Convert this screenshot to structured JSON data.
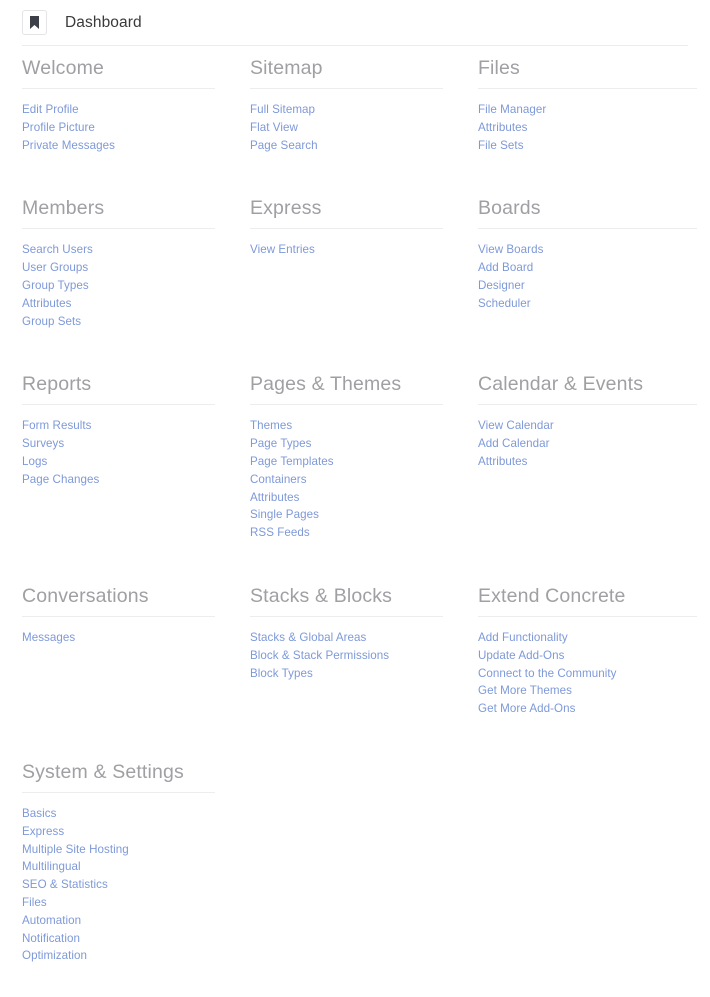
{
  "header": {
    "icon": "bookmark-icon",
    "title": "Dashboard"
  },
  "colors": {
    "link": "#7e99d8",
    "heading": "#a0a0a4",
    "title": "#3a3a3c",
    "divider": "#ededef",
    "background": "#ffffff"
  },
  "groups": [
    {
      "id": "welcome",
      "title": "Welcome",
      "links": [
        "Edit Profile",
        "Profile Picture",
        "Private Messages"
      ]
    },
    {
      "id": "sitemap",
      "title": "Sitemap",
      "links": [
        "Full Sitemap",
        "Flat View",
        "Page Search"
      ]
    },
    {
      "id": "files",
      "title": "Files",
      "links": [
        "File Manager",
        "Attributes",
        "File Sets"
      ]
    },
    {
      "id": "members",
      "title": "Members",
      "links": [
        "Search Users",
        "User Groups",
        "Group Types",
        "Attributes",
        "Group Sets"
      ]
    },
    {
      "id": "express",
      "title": "Express",
      "links": [
        "View Entries"
      ]
    },
    {
      "id": "boards",
      "title": "Boards",
      "links": [
        "View Boards",
        "Add Board",
        "Designer",
        "Scheduler"
      ]
    },
    {
      "id": "reports",
      "title": "Reports",
      "links": [
        "Form Results",
        "Surveys",
        "Logs",
        "Page Changes"
      ]
    },
    {
      "id": "pages-themes",
      "title": "Pages & Themes",
      "links": [
        "Themes",
        "Page Types",
        "Page Templates",
        "Containers",
        "Attributes",
        "Single Pages",
        "RSS Feeds"
      ]
    },
    {
      "id": "calendar-events",
      "title": "Calendar & Events",
      "links": [
        "View Calendar",
        "Add Calendar",
        "Attributes"
      ]
    },
    {
      "id": "conversations",
      "title": "Conversations",
      "links": [
        "Messages"
      ]
    },
    {
      "id": "stacks-blocks",
      "title": "Stacks & Blocks",
      "links": [
        "Stacks & Global Areas",
        "Block & Stack Permissions",
        "Block Types"
      ]
    },
    {
      "id": "extend-concrete",
      "title": "Extend Concrete",
      "links": [
        "Add Functionality",
        "Update Add-Ons",
        "Connect to the Community",
        "Get More Themes",
        "Get More Add-Ons"
      ]
    },
    {
      "id": "system-settings",
      "title": "System & Settings",
      "links": [
        "Basics",
        "Express",
        "Multiple Site Hosting",
        "Multilingual",
        "SEO & Statistics",
        "Files",
        "Automation",
        "Notification",
        "Optimization"
      ]
    }
  ]
}
